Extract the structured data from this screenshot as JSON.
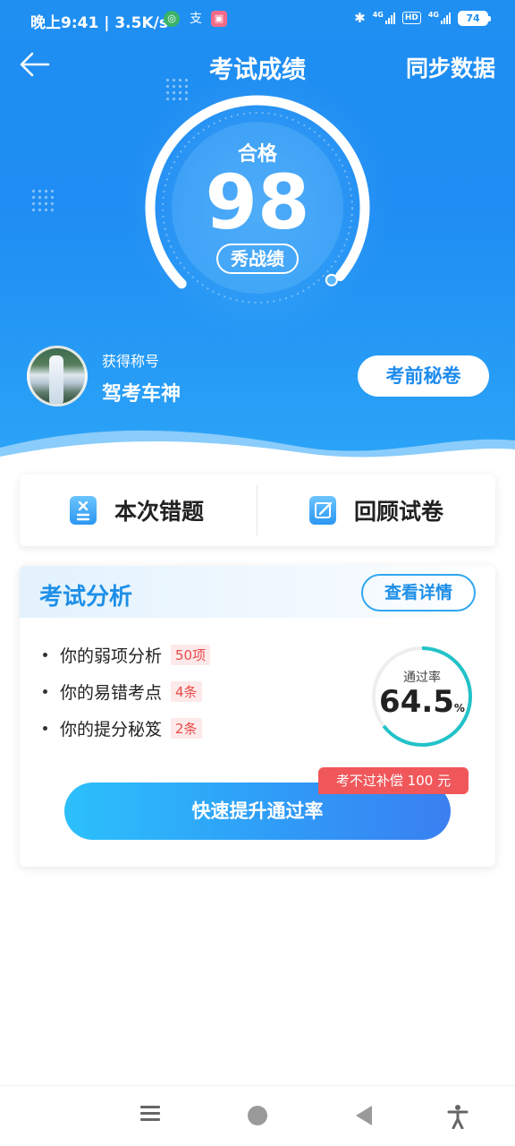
{
  "status_bar": {
    "time": "晚上9:41 | 3.5K/s",
    "network_a": "4G",
    "hd": "HD",
    "network_b": "4G",
    "battery": "74"
  },
  "nav": {
    "title": "考试成绩",
    "sync": "同步数据"
  },
  "score": {
    "status": "合格",
    "value": "98",
    "share_button": "秀战绩"
  },
  "profile": {
    "title_label": "获得称号",
    "title_value": "驾考车神",
    "secret_button": "考前秘卷"
  },
  "actions": {
    "wrong_questions": "本次错题",
    "review_paper": "回顾试卷"
  },
  "analysis": {
    "title": "考试分析",
    "detail_button": "查看详情",
    "items": [
      {
        "label": "你的弱项分析",
        "tag": "50项"
      },
      {
        "label": "你的易错考点",
        "tag": "4条"
      },
      {
        "label": "你的提分秘笈",
        "tag": "2条"
      }
    ],
    "pass_rate_label": "通过率",
    "pass_rate_value": "64.5",
    "pass_rate_unit": "%",
    "pass_rate_percent": 64.5,
    "guarantee_badge": "考不过补偿 100 元",
    "cta_button": "快速提升通过率"
  },
  "colors": {
    "brand_blue": "#1f8ff2",
    "accent_red": "#f0575a",
    "tag_red": "#e84a4a"
  }
}
